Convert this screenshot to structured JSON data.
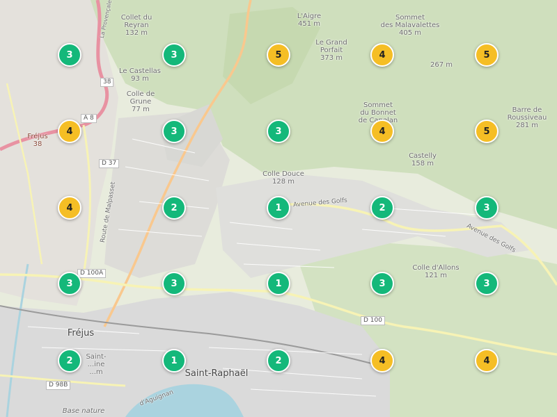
{
  "colors": {
    "cluster_low": "#14b87a",
    "cluster_high": "#f5be25",
    "urban": "#dcdcdc",
    "forest": "#c9dbb4",
    "sea": "#aad3df"
  },
  "clusters": [
    {
      "count": "3",
      "level": "green"
    },
    {
      "count": "3",
      "level": "green"
    },
    {
      "count": "5",
      "level": "yellow"
    },
    {
      "count": "4",
      "level": "yellow"
    },
    {
      "count": "5",
      "level": "yellow"
    },
    {
      "count": "4",
      "level": "yellow"
    },
    {
      "count": "3",
      "level": "green"
    },
    {
      "count": "3",
      "level": "green"
    },
    {
      "count": "4",
      "level": "yellow"
    },
    {
      "count": "5",
      "level": "yellow"
    },
    {
      "count": "4",
      "level": "yellow"
    },
    {
      "count": "2",
      "level": "green"
    },
    {
      "count": "1",
      "level": "green"
    },
    {
      "count": "2",
      "level": "green"
    },
    {
      "count": "3",
      "level": "green"
    },
    {
      "count": "3",
      "level": "green"
    },
    {
      "count": "3",
      "level": "green"
    },
    {
      "count": "1",
      "level": "green"
    },
    {
      "count": "3",
      "level": "green"
    },
    {
      "count": "3",
      "level": "green"
    },
    {
      "count": "2",
      "level": "green"
    },
    {
      "count": "1",
      "level": "green"
    },
    {
      "count": "2",
      "level": "green"
    },
    {
      "count": "4",
      "level": "yellow"
    },
    {
      "count": "4",
      "level": "yellow"
    }
  ],
  "labels": {
    "collet_du_reyran": "Collet du\nReyran\n132 m",
    "l_aigre": "L'Aigre\n451 m",
    "sommet_malavalettes": "Sommet\ndes Malavalettes\n405 m",
    "le_grand_porfait": "Le Grand\nPorfait\n373 m",
    "le_castellas": "Le Castellas\n93 m",
    "colle_de_grune": "Colle de\nGrune\n77 m",
    "peak_267": "267 m",
    "sommet_bonnet": "Sommet\ndu Bonnet\nde Capelan",
    "barre_roussiveau": "Barre de\nRoussiveau\n281 m",
    "castelly": "Castelly\n158 m",
    "colle_douce": "Colle Douce\n128 m",
    "colle_d_allons": "Colle d'Allons\n121 m",
    "frejus_small": "Fréjus\n38",
    "frejus": "Fréjus",
    "saint_raphael": "Saint-Raphaël",
    "avenue_des_golfs_1": "Avenue des Golfs",
    "avenue_des_golfs_2": "Avenue des Golfs",
    "route_de_malpasset": "Route de Malpasset",
    "la_provencale": "La Provençale",
    "base_nature": "Base nature",
    "d_aguignan": "d'Aguignan",
    "saint_aygulf": "Saint-\n...ine\n...m",
    "road_a8": "A 8",
    "road_38": "38",
    "road_d37": "D 37",
    "road_d100a": "D 100A",
    "road_d100": "D 100",
    "road_d98b": "D 98B"
  }
}
